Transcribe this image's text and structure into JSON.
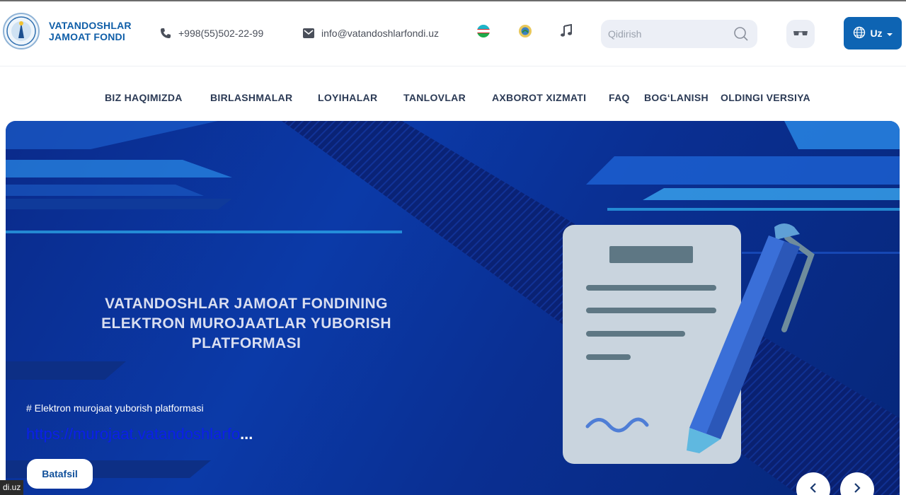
{
  "header": {
    "brand_line1": "VATANDOSHLAR",
    "brand_line2": "JAMOAT FONDI",
    "phone": "+998(55)502-22-99",
    "email": "info@vatandoshlarfondi.uz",
    "search_placeholder": "Qidirish",
    "language": "Uz",
    "icons": [
      "phone-icon",
      "mail-icon",
      "flag-icon",
      "emblem-icon",
      "music-note-icon",
      "search-icon",
      "glasses-icon",
      "globe-icon",
      "caret-down-icon"
    ]
  },
  "nav": {
    "items": [
      "BIZ HAQIMIZDA",
      "BIRLASHMALAR",
      "LOYIHALAR",
      "TANLOVLAR",
      "AXBOROT XIZMATI",
      "FAQ",
      "BOG‘LANISH",
      "OLDINGI VERSIYA"
    ]
  },
  "banner": {
    "title_line1": "VATANDOSHLAR JAMOAT FONDINING",
    "title_line2": "ELEKTRON MUROJAATLAR YUBORISH",
    "title_line3": "PLATFORMASI",
    "tag": "# Elektron murojaat yuborish platformasi",
    "link": "https://murojaat.vatandoshlarfo",
    "ellipsis": "...",
    "button": "Batafsil"
  },
  "status_bar": "di.uz",
  "colors": {
    "brand_blue": "#0f5ea8",
    "button_blue": "#0e64b3",
    "nav_text": "#2b3a55",
    "banner_bg": "#0b3aa8"
  }
}
